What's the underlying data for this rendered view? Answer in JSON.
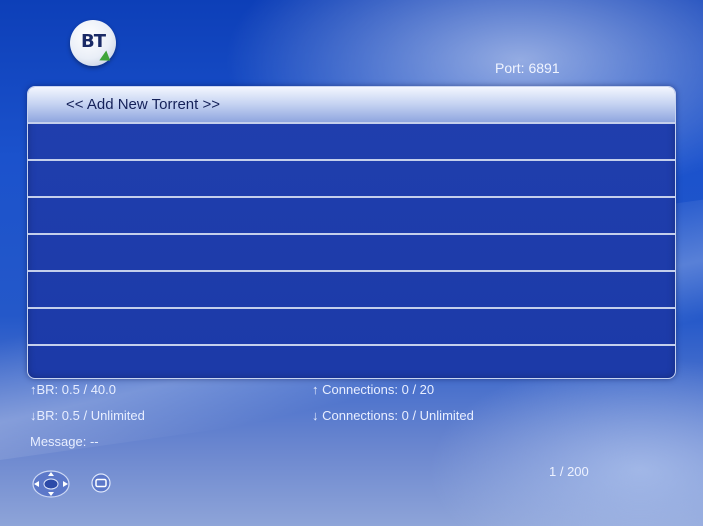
{
  "header": {
    "logo_text": "BT",
    "port_label": "Port: 6891"
  },
  "torrent_list": {
    "rows": [
      {
        "label": "<< Add New Torrent >>",
        "selected": true
      },
      {
        "label": ""
      },
      {
        "label": ""
      },
      {
        "label": ""
      },
      {
        "label": ""
      },
      {
        "label": ""
      },
      {
        "label": ""
      },
      {
        "label": ""
      }
    ]
  },
  "stats": {
    "up_br": "↑BR:  0.5 /  40.0",
    "down_br": "↓BR:  0.5 / Unlimited",
    "up_connections": "↑ Connections: 0 / 20",
    "down_connections": "↓ Connections: 0 / Unlimited",
    "message": "Message: --"
  },
  "footer": {
    "page_count": "1 / 200",
    "nav_icon": "dpad-icon",
    "menu_icon": "menu-button-icon"
  },
  "colors": {
    "accent": "#1c3aa8",
    "selection": "#c9d6f3",
    "text_light": "#e8eeff"
  }
}
